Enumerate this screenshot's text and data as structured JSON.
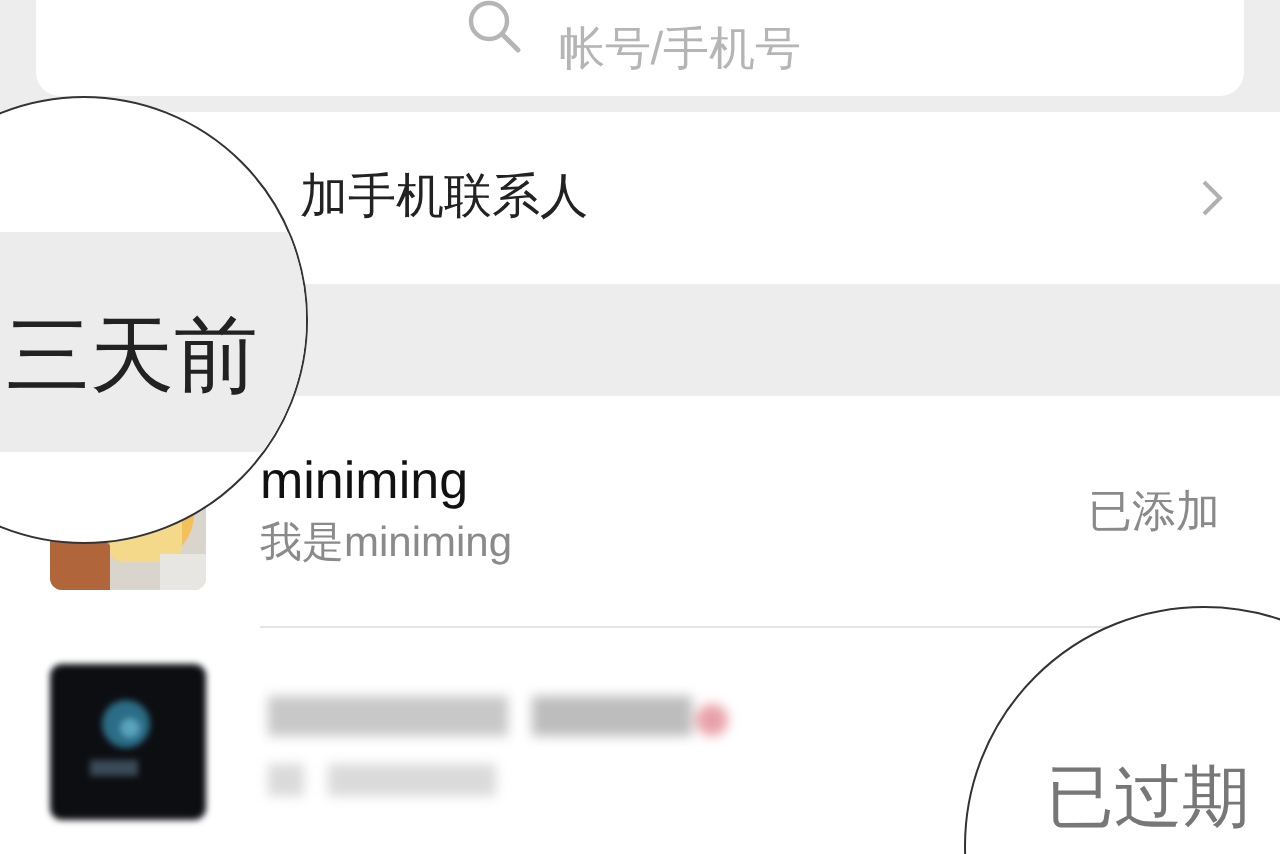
{
  "search": {
    "placeholder": "帐号/手机号"
  },
  "add_contacts": {
    "label": "加手机联系人"
  },
  "section": {
    "label": "三天前"
  },
  "requests": [
    {
      "kind": "contact",
      "name": "miniming",
      "message": "我是miniming",
      "status": "已添加"
    },
    {
      "kind": "blurred",
      "status": "已过期"
    }
  ]
}
